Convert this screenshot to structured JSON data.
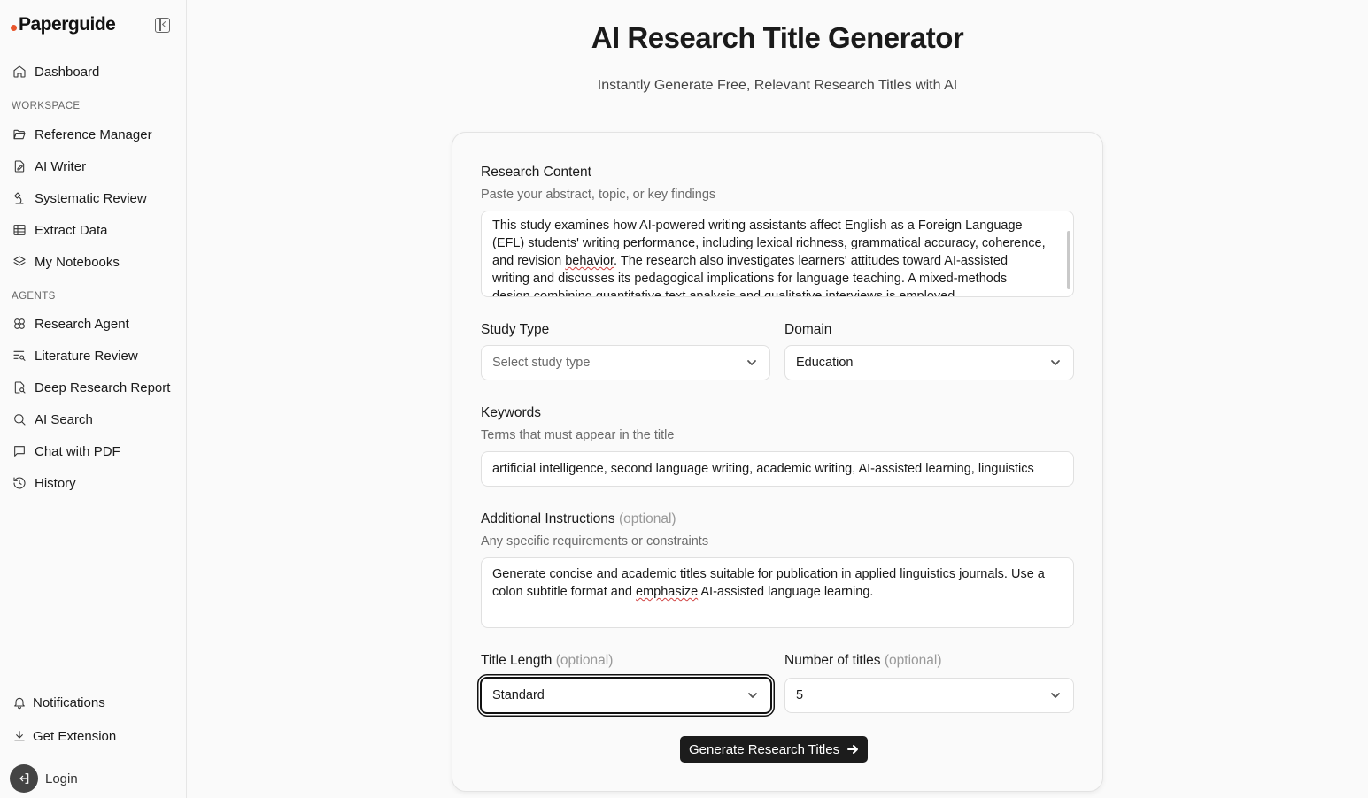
{
  "brand": {
    "name": "Paperguide",
    "accent": "#e8552b"
  },
  "sidebar": {
    "top_items": [
      {
        "label": "Dashboard",
        "icon": "home-icon"
      }
    ],
    "workspace_label": "WORKSPACE",
    "workspace_items": [
      {
        "label": "Reference Manager",
        "icon": "folder-icon"
      },
      {
        "label": "AI Writer",
        "icon": "pen-file-icon"
      },
      {
        "label": "Systematic Review",
        "icon": "microscope-icon"
      },
      {
        "label": "Extract Data",
        "icon": "table-icon"
      },
      {
        "label": "My Notebooks",
        "icon": "layers-icon"
      }
    ],
    "agents_label": "AGENTS",
    "agents_items": [
      {
        "label": "Research Agent",
        "icon": "agent-icon"
      },
      {
        "label": "Literature Review",
        "icon": "list-search-icon"
      },
      {
        "label": "Deep Research Report",
        "icon": "file-search-icon"
      },
      {
        "label": "AI Search",
        "icon": "search-icon"
      },
      {
        "label": "Chat with PDF",
        "icon": "chat-icon"
      },
      {
        "label": "History",
        "icon": "history-icon"
      }
    ],
    "bottom_items": [
      {
        "label": "Notifications",
        "icon": "bell-icon"
      },
      {
        "label": "Get Extension",
        "icon": "download-icon"
      }
    ],
    "login_label": "Login"
  },
  "main": {
    "title": "AI Research Title Generator",
    "subtitle": "Instantly Generate Free, Relevant Research Titles with AI"
  },
  "form": {
    "research_content": {
      "label": "Research Content",
      "hint": "Paste your abstract, topic, or key findings",
      "value_before": "This study examines how AI-powered writing assistants affect English as a Foreign Language (EFL) students' writing performance, including lexical richness, grammatical accuracy, coherence, and revision ",
      "value_flagged": "behavior",
      "value_after": ". The research also investigates learners' attitudes toward AI-assisted writing and discusses its pedagogical implications for language teaching. A mixed-methods design combining quantitative text analysis and qualitative interviews is employed."
    },
    "study_type": {
      "label": "Study Type",
      "placeholder": "Select study type"
    },
    "domain": {
      "label": "Domain",
      "value": "Education"
    },
    "keywords": {
      "label": "Keywords",
      "hint": "Terms that must appear in the title",
      "value": "artificial intelligence, second language writing, academic writing, AI-assisted learning, linguistics"
    },
    "additional": {
      "label": "Additional Instructions",
      "optional": "(optional)",
      "hint": "Any specific requirements or constraints",
      "value_before": "Generate concise and academic titles suitable for publication in applied linguistics journals. Use a colon subtitle format and ",
      "value_flagged": "emphasize",
      "value_after": " AI-assisted language learning."
    },
    "title_length": {
      "label": "Title Length",
      "optional": "(optional)",
      "value": "Standard"
    },
    "num_titles": {
      "label": "Number of titles",
      "optional": "(optional)",
      "value": "5"
    },
    "submit_label": "Generate Research Titles"
  }
}
